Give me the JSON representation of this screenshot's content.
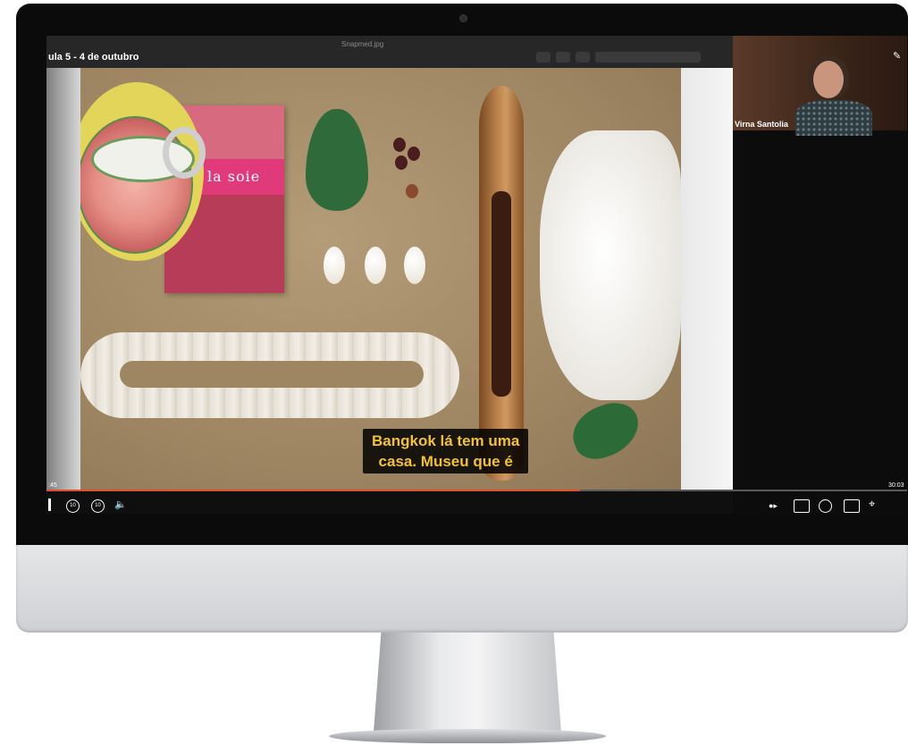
{
  "player": {
    "title": "ula 5 - 4 de outubro",
    "file_name": "Snapmed.jpg",
    "subtitle_lines": "Bangkok lá tem uma\ncasa. Museu que é",
    "time_current": ":45",
    "time_total": "30:03",
    "progress_fraction": 0.62,
    "rewind_label": "10",
    "forward_label": "10"
  },
  "scene": {
    "book_title": "la soie"
  },
  "participant": {
    "name": "Virna Santolia"
  },
  "icons": {
    "play_pause": "pause-icon",
    "rewind": "rewind-10-icon",
    "forward": "forward-10-icon",
    "volume": "volume-icon",
    "speed": "speed-icon",
    "captions": "captions-icon",
    "settings": "settings-icon",
    "pip": "picture-in-picture-icon",
    "fullscreen": "exit-fullscreen-icon",
    "pin": "pin-icon"
  },
  "colors": {
    "progress": "#e0502f",
    "subtitle_text": "#f2c230",
    "subtitle_bg": "#000000"
  }
}
